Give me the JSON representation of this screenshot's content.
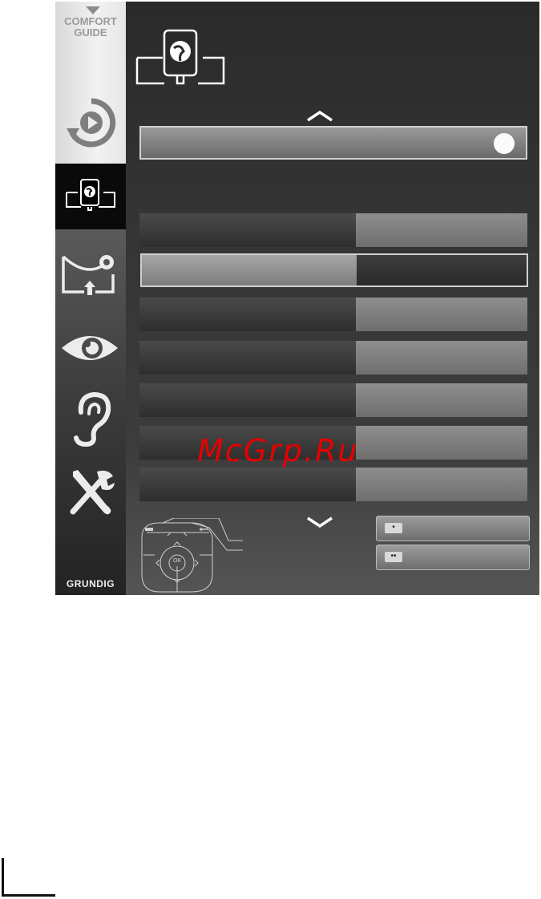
{
  "sidebar": {
    "comfort_guide": "COMFORT\nGUIDE",
    "brand": "GRUNDIG",
    "items": [
      {
        "icon": "play-circle-icon"
      },
      {
        "icon": "network-globe-icon",
        "active": true
      },
      {
        "icon": "source-input-icon"
      },
      {
        "icon": "eye-icon"
      },
      {
        "icon": "ear-icon"
      },
      {
        "icon": "tools-icon"
      }
    ]
  },
  "header": {
    "icon": "network-globe-icon"
  },
  "rows": [
    {
      "label": "",
      "value": ""
    },
    {
      "label": "",
      "value": "",
      "selected": true
    },
    {
      "label": "",
      "value": ""
    },
    {
      "label": "",
      "value": ""
    },
    {
      "label": "",
      "value": ""
    },
    {
      "label": "",
      "value": ""
    },
    {
      "label": "",
      "value": ""
    }
  ],
  "remote": {
    "ok_label": "OK"
  },
  "buttons": [
    {
      "key": "•",
      "label": ""
    },
    {
      "key": "••",
      "label": ""
    }
  ],
  "watermark": "McGrp.Ru",
  "colors": {
    "accent_text": "#e60000",
    "panel": "#3a3a3a",
    "value_field": "#808080"
  }
}
